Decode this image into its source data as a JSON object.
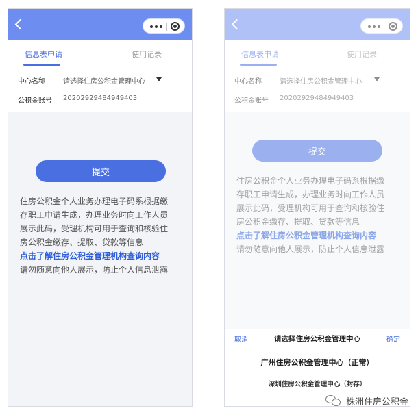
{
  "tabs": {
    "apply": "信息表申请",
    "records": "使用记录"
  },
  "form": {
    "center_label": "中心名称",
    "center_placeholder": "请选择住房公积金管理中心",
    "account_label": "公积金账号",
    "account_value": "20202929484949403"
  },
  "submit_label": "提交",
  "notice": {
    "line1": "住房公积金个人业务办理电子码系根据缴",
    "line2": "存职工申请生成，办理业务时向工作人员",
    "line3": "展示此码，受理机构可用于查询和核验住",
    "line4": "房公积金缴存、提取、贷款等信息",
    "link": "点击了解住房公积金管理机构查询内容",
    "line5": "请勿随意向他人展示，防止个人信息泄露"
  },
  "picker": {
    "cancel": "取消",
    "title": "请选择住房公积金管理中心",
    "confirm": "确定",
    "option_1": "广州住房公积金管理中心（正常）",
    "option_2": "深圳住房公积金管理中心（封存）"
  },
  "watermark": "株洲住房公积金",
  "colors": {
    "topbar": "#6d8ef0",
    "accent": "#4a6fe0",
    "link": "#2d5ed8"
  }
}
